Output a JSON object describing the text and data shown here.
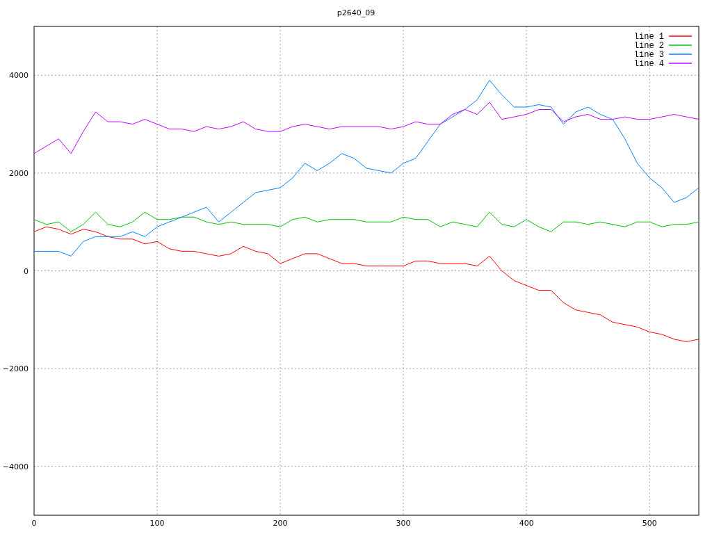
{
  "chart_data": {
    "type": "line",
    "title": "p2640_09",
    "x": [
      0,
      10,
      20,
      30,
      40,
      50,
      60,
      70,
      80,
      90,
      100,
      110,
      120,
      130,
      140,
      150,
      160,
      170,
      180,
      190,
      200,
      210,
      220,
      230,
      240,
      250,
      260,
      270,
      280,
      290,
      300,
      310,
      320,
      330,
      340,
      350,
      360,
      370,
      380,
      390,
      400,
      410,
      420,
      430,
      440,
      450,
      460,
      470,
      480,
      490,
      500,
      510,
      520,
      530,
      540
    ],
    "series": [
      {
        "name": "line 1",
        "color": "#ff0000",
        "values": [
          800,
          900,
          850,
          750,
          850,
          800,
          700,
          650,
          650,
          550,
          600,
          450,
          400,
          400,
          350,
          300,
          350,
          500,
          400,
          350,
          150,
          250,
          350,
          350,
          250,
          150,
          150,
          100,
          100,
          100,
          100,
          200,
          200,
          150,
          150,
          150,
          100,
          300,
          0,
          -200,
          -300,
          -400,
          -400,
          -650,
          -800,
          -850,
          -900,
          -1050,
          -1100,
          -1150,
          -1250,
          -1300,
          -1400,
          -1450,
          -1400
        ]
      },
      {
        "name": "line 2",
        "color": "#00c000",
        "values": [
          1050,
          950,
          1000,
          800,
          950,
          1200,
          950,
          900,
          1000,
          1200,
          1050,
          1050,
          1100,
          1100,
          1000,
          950,
          1000,
          950,
          950,
          950,
          900,
          1050,
          1100,
          1000,
          1050,
          1050,
          1050,
          1000,
          1000,
          1000,
          1100,
          1050,
          1050,
          900,
          1000,
          950,
          900,
          1200,
          950,
          900,
          1050,
          900,
          800,
          1000,
          1000,
          950,
          1000,
          950,
          900,
          1000,
          1000,
          900,
          950,
          950,
          1000
        ]
      },
      {
        "name": "line 3",
        "color": "#0080ff",
        "values": [
          400,
          400,
          400,
          300,
          600,
          700,
          700,
          700,
          800,
          700,
          900,
          1000,
          1100,
          1200,
          1300,
          1000,
          1200,
          1400,
          1600,
          1650,
          1700,
          1900,
          2200,
          2050,
          2200,
          2400,
          2300,
          2100,
          2050,
          2000,
          2200,
          2300,
          2650,
          3000,
          3150,
          3300,
          3500,
          3900,
          3600,
          3350,
          3350,
          3400,
          3350,
          3000,
          3250,
          3350,
          3200,
          3100,
          2700,
          2200,
          1900,
          1700,
          1400,
          1500,
          1700
        ]
      },
      {
        "name": "line 4",
        "color": "#c000ff",
        "values": [
          2400,
          2550,
          2700,
          2400,
          2850,
          3250,
          3050,
          3050,
          3000,
          3100,
          3000,
          2900,
          2900,
          2850,
          2950,
          2900,
          2950,
          3050,
          2900,
          2850,
          2850,
          2950,
          3000,
          2950,
          2900,
          2950,
          2950,
          2950,
          2950,
          2900,
          2950,
          3050,
          3000,
          3000,
          3200,
          3300,
          3200,
          3450,
          3100,
          3150,
          3200,
          3300,
          3300,
          3050,
          3150,
          3200,
          3100,
          3100,
          3150,
          3100,
          3100,
          3150,
          3200,
          3150,
          3100
        ]
      }
    ],
    "xlim": [
      0,
      540
    ],
    "ylim": [
      -5000,
      5000
    ],
    "xticks": [
      0,
      100,
      200,
      300,
      400,
      500
    ],
    "yticks": [
      -4000,
      -2000,
      0,
      2000,
      4000
    ],
    "grid": true,
    "legend": true
  }
}
